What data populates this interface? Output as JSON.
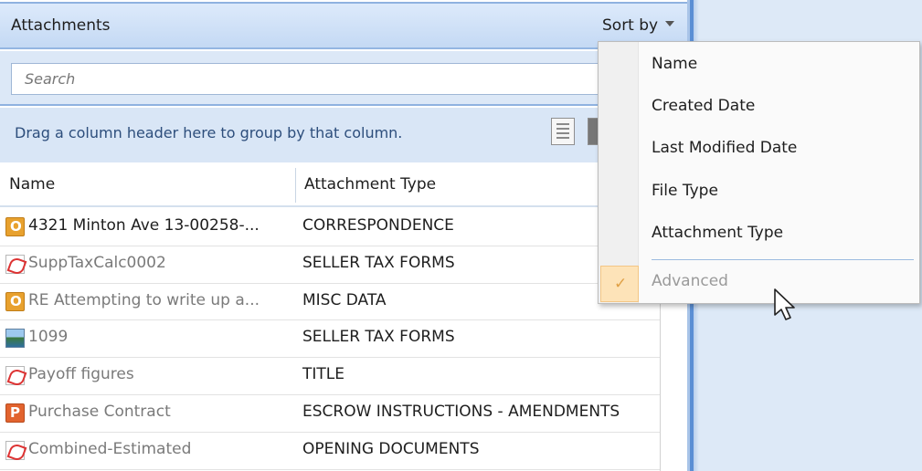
{
  "header": {
    "title": "Attachments",
    "sort_label": "Sort by"
  },
  "search": {
    "placeholder": "Search"
  },
  "group": {
    "hint": "Drag a column header here to group by that column."
  },
  "columns": {
    "name": "Name",
    "type": "Attachment Type"
  },
  "rows": [
    {
      "icon": "outlook-icon",
      "name": "4321 Minton Ave 13-00258-...",
      "type": "CORRESPONDENCE"
    },
    {
      "icon": "pdf-icon",
      "name": "SuppTaxCalc0002",
      "type": "SELLER TAX FORMS"
    },
    {
      "icon": "outlook-icon",
      "name": "RE  Attempting to write up a...",
      "type": "MISC DATA"
    },
    {
      "icon": "image-icon",
      "name": "1099",
      "type": "SELLER TAX FORMS"
    },
    {
      "icon": "pdf-icon",
      "name": "Payoff figures",
      "type": "TITLE"
    },
    {
      "icon": "powerpoint-icon",
      "name": "Purchase Contract",
      "type": "ESCROW INSTRUCTIONS - AMENDMENTS"
    },
    {
      "icon": "pdf-icon",
      "name": "Combined-Estimated",
      "type": "OPENING DOCUMENTS"
    }
  ],
  "sort_menu": {
    "items": [
      "Name",
      "Created Date",
      "Last Modified Date",
      "File Type",
      "Attachment Type"
    ],
    "advanced": "Advanced",
    "advanced_checked": true,
    "advanced_enabled": false
  },
  "colors": {
    "accent": "#5b8fd4",
    "header_bg": "#c4d9f4",
    "check_highlight": "#fde3b8"
  }
}
